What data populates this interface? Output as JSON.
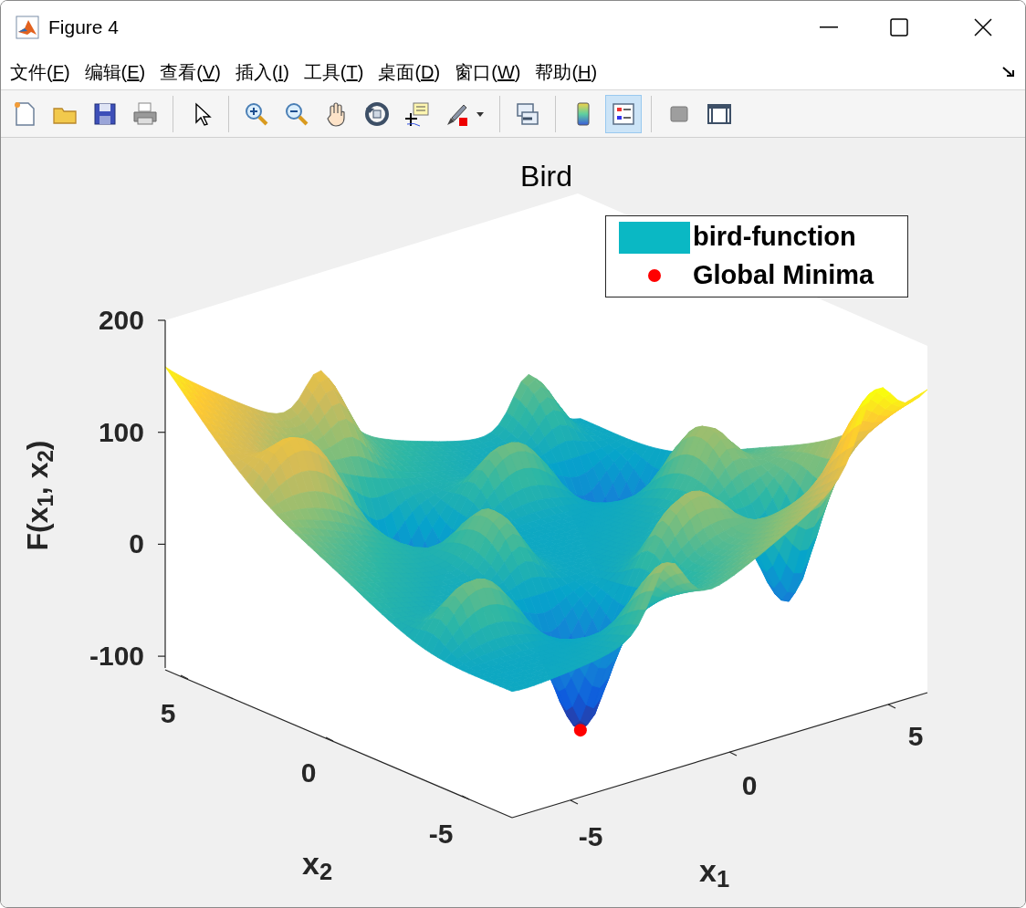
{
  "window": {
    "title": "Figure 4"
  },
  "menu": [
    {
      "before": "文件(",
      "key": "F",
      "after": ")"
    },
    {
      "before": "编辑(",
      "key": "E",
      "after": ")"
    },
    {
      "before": "查看(",
      "key": "V",
      "after": ")"
    },
    {
      "before": "插入(",
      "key": "I",
      "after": ")"
    },
    {
      "before": "工具(",
      "key": "T",
      "after": ")"
    },
    {
      "before": "桌面(",
      "key": "D",
      "after": ")"
    },
    {
      "before": "窗口(",
      "key": "W",
      "after": ")"
    },
    {
      "before": "帮助(",
      "key": "H",
      "after": ")"
    }
  ],
  "toolbar": [
    {
      "kind": "new",
      "selected": false
    },
    {
      "kind": "open",
      "selected": false
    },
    {
      "kind": "save",
      "selected": false
    },
    {
      "kind": "print",
      "selected": false
    },
    {
      "kind": "separator"
    },
    {
      "kind": "pointer",
      "selected": false
    },
    {
      "kind": "separator"
    },
    {
      "kind": "zoom-in",
      "selected": false
    },
    {
      "kind": "zoom-out",
      "selected": false
    },
    {
      "kind": "pan",
      "selected": false
    },
    {
      "kind": "rotate",
      "selected": false
    },
    {
      "kind": "data-tips",
      "selected": false
    },
    {
      "kind": "brush",
      "selected": false
    },
    {
      "kind": "separator"
    },
    {
      "kind": "link",
      "selected": false
    },
    {
      "kind": "separator"
    },
    {
      "kind": "colorbar",
      "selected": false
    },
    {
      "kind": "legend",
      "selected": true
    },
    {
      "kind": "separator"
    },
    {
      "kind": "hide-tools",
      "selected": false
    },
    {
      "kind": "show-tools",
      "selected": false
    }
  ],
  "plot": {
    "title": "Bird",
    "legend": [
      {
        "kind": "patch",
        "label": "bird-function",
        "color": "#0ab8c4"
      },
      {
        "kind": "marker",
        "label": "Global Minima",
        "color": "#ff0000"
      }
    ],
    "zlabel": "F(x$_{1}$, x$_{2}$)",
    "xlabel": "x$_{1}$",
    "ylabel": "x$_{2}$",
    "zticks": [
      "200",
      "100",
      "0",
      "-100"
    ],
    "x2ticks": [
      "5",
      "0",
      "-5"
    ],
    "x1ticks": [
      "-5",
      "0",
      "5"
    ]
  }
}
